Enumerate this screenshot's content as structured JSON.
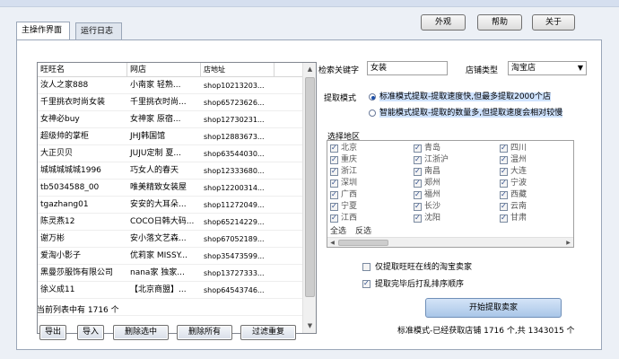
{
  "toolbar": {
    "appearance_label": "外观",
    "help_label": "帮助",
    "about_label": "关于"
  },
  "tabs": [
    {
      "label": "主操作界面"
    },
    {
      "label": "运行日志"
    }
  ],
  "table": {
    "headers": [
      "旺旺名",
      "网店",
      "店地址"
    ],
    "rows": [
      [
        "汝人之家888",
        "小南家 轻熟...",
        "shop10213203..."
      ],
      [
        "千里挑衣时尚女装",
        "千里挑衣时尚...",
        "shop65723626..."
      ],
      [
        "女神必buy",
        "女神家 原宿...",
        "shop12730231..."
      ],
      [
        "超级帅的掌柜",
        "JHJ韩国馆",
        "shop12883673..."
      ],
      [
        "大正贝贝",
        "JUJU定制 夏...",
        "shop63544030..."
      ],
      [
        "城城城城城1996",
        "巧女人的春天",
        "shop12333680..."
      ],
      [
        "tb5034588_00",
        "唯美精致女装屋",
        "shop12200314..."
      ],
      [
        "tgazhang01",
        "安安的大耳朵...",
        "shop11272049..."
      ],
      [
        "陈灵燕12",
        "COCO日韩大码...",
        "shop65214229..."
      ],
      [
        "谢万彬",
        "安小落文艺森...",
        "shop67052189..."
      ],
      [
        "爱淘小影子",
        "优莉家 MISSY...",
        "shop35473599..."
      ],
      [
        "黑曼莎服饰有限公司",
        "nana家 独家...",
        "shop13727333..."
      ],
      [
        "徐义成11",
        "【北京商盟】...",
        "shop64543746..."
      ],
      [
        "",
        "",
        ""
      ]
    ]
  },
  "status": {
    "list_count": "当前列表中有 1716 个",
    "progress": "标准模式-已经获取店铺 1716 个,共 1343015 个"
  },
  "buttons": {
    "export": "导出",
    "import": "导入",
    "delete_selected": "删除选中",
    "delete_all": "删除所有",
    "filter_dup": "过滤重复",
    "start": "开始提取卖家"
  },
  "search": {
    "keyword_label": "检索关键字",
    "keyword_value": "女装",
    "shop_type_label": "店铺类型",
    "shop_type_value": "淘宝店",
    "mode_label": "提取模式",
    "mode_standard": "标准模式提取-提取速度快,但最多提取2000个店",
    "mode_smart": "智能模式提取-提取的数量多,但提取速度会相对较慢",
    "region_label": "选择地区",
    "regions_col1": [
      "北京",
      "重庆",
      "浙江",
      "深圳",
      "广西",
      "宁夏",
      "江西"
    ],
    "regions_col2": [
      "青岛",
      "江浙沪",
      "南昌",
      "郑州",
      "福州",
      "长沙",
      "沈阳"
    ],
    "regions_col3": [
      "四川",
      "温州",
      "大连",
      "宁波",
      "西藏",
      "云南",
      "甘肃"
    ],
    "select_all": "全选",
    "invert": "反选",
    "only_online": "仅提取旺旺在线的淘宝卖家",
    "shuffle": "提取完毕后打乱排序顺序"
  }
}
